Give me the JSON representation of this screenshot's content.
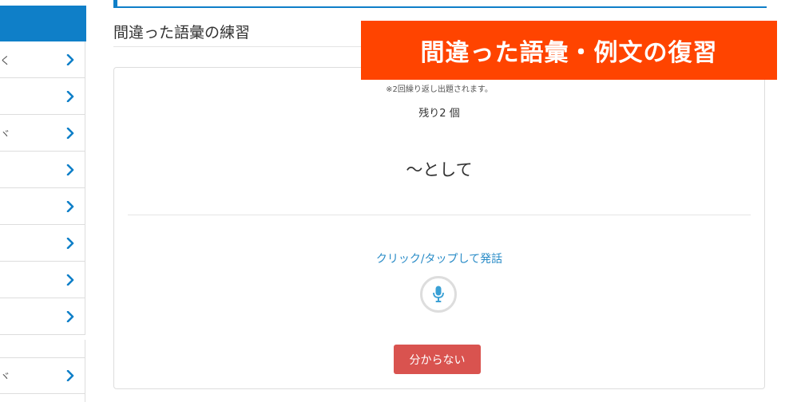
{
  "sidebar": {
    "items": [
      {
        "label": "く",
        "chevron": "chevron-right-icon"
      },
      {
        "label": "",
        "chevron": "chevron-right-icon"
      },
      {
        "label": "ヾ",
        "chevron": "chevron-right-icon"
      },
      {
        "label": "",
        "chevron": "chevron-right-icon"
      },
      {
        "label": "",
        "chevron": "chevron-right-icon"
      },
      {
        "label": "",
        "chevron": "chevron-right-icon"
      },
      {
        "label": "",
        "chevron": "chevron-right-icon"
      },
      {
        "label": "",
        "chevron": "chevron-right-icon"
      },
      {
        "label": "ヾ",
        "chevron": "chevron-right-icon"
      }
    ]
  },
  "page": {
    "title": "間違った語彙の練習"
  },
  "banner": {
    "text": "間違った語彙・例文の復習"
  },
  "card": {
    "note": "※2回繰り返し出題されます。",
    "remaining": "残り2 個",
    "word": "～として",
    "speak_link": "クリック/タップして発話",
    "mic_icon": "microphone-icon",
    "dont_know_label": "分からない"
  },
  "colors": {
    "accent_blue": "#0f7fc8",
    "banner_orange": "#ff4400",
    "link_blue": "#2a8cc7",
    "danger_red": "#d9534f",
    "mic_blue": "#3aa0d5"
  }
}
